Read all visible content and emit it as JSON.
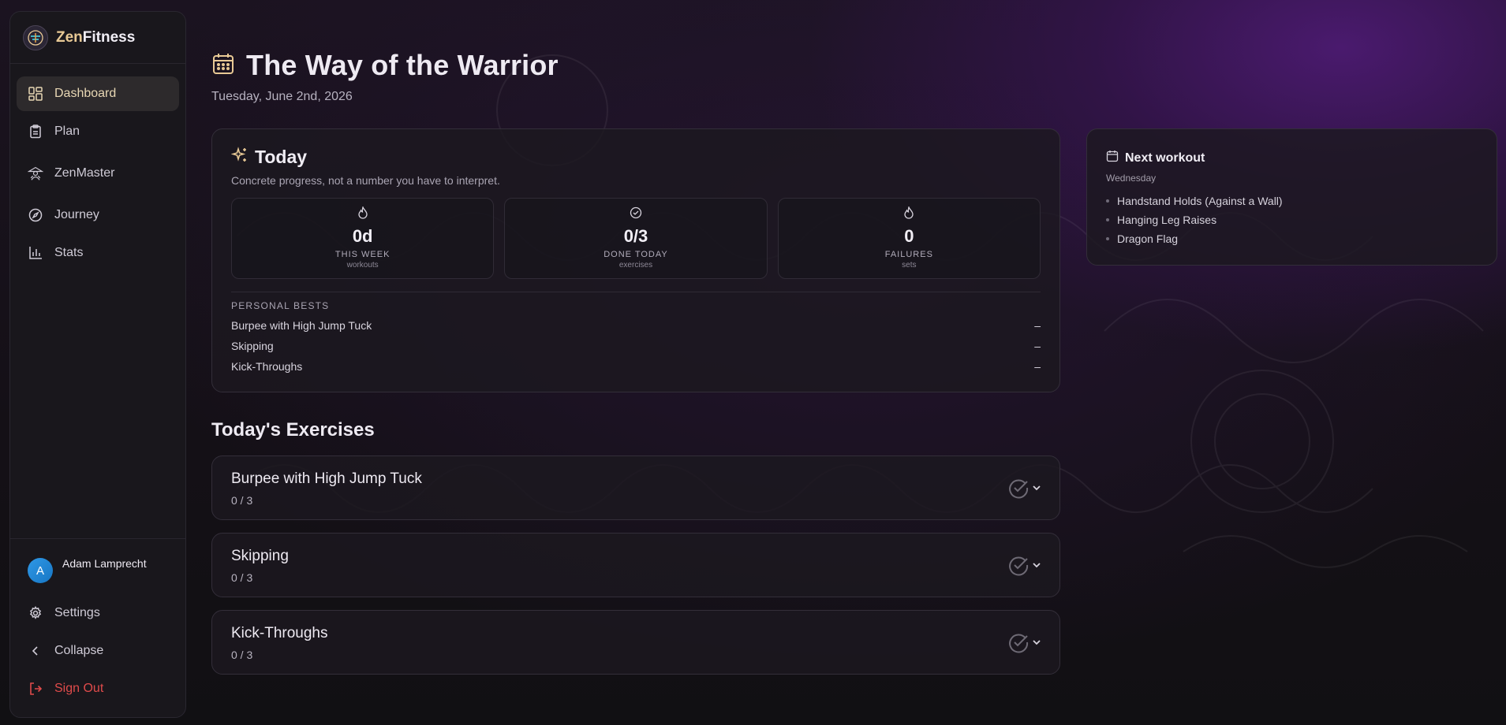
{
  "brand": {
    "name_prefix": "Zen",
    "name_suffix": "Fitness"
  },
  "sidebar": {
    "items": [
      {
        "label": "Dashboard",
        "icon": "dashboard-icon",
        "active": true
      },
      {
        "label": "Plan",
        "icon": "clipboard-icon",
        "active": false
      },
      {
        "label": "ZenMaster",
        "icon": "master-icon",
        "active": false
      },
      {
        "label": "Journey",
        "icon": "compass-icon",
        "active": false
      },
      {
        "label": "Stats",
        "icon": "bar-chart-icon",
        "active": false
      }
    ],
    "user": {
      "initial": "A",
      "name": "Adam Lamprecht"
    },
    "settings_label": "Settings",
    "collapse_label": "Collapse",
    "signout_label": "Sign Out"
  },
  "header": {
    "title": "The Way of the Warrior",
    "date": "Tuesday, June 2nd, 2026"
  },
  "today": {
    "title": "Today",
    "subtitle": "Concrete progress, not a number you have to interpret.",
    "stats": [
      {
        "value": "0d",
        "label": "THIS WEEK",
        "unit": "workouts",
        "icon": "flame-icon"
      },
      {
        "value": "0/3",
        "label": "DONE TODAY",
        "unit": "exercises",
        "icon": "check-circle-icon"
      },
      {
        "value": "0",
        "label": "FAILURES",
        "unit": "sets",
        "icon": "flame-icon"
      }
    ],
    "personal_bests_heading": "PERSONAL BESTS",
    "personal_bests": [
      {
        "name": "Burpee with High Jump Tuck",
        "value": "–"
      },
      {
        "name": "Skipping",
        "value": "–"
      },
      {
        "name": "Kick-Throughs",
        "value": "–"
      }
    ]
  },
  "next_workout": {
    "title": "Next workout",
    "day": "Wednesday",
    "exercises": [
      "Handstand Holds (Against a Wall)",
      "Hanging Leg Raises",
      "Dragon Flag"
    ]
  },
  "exercises_section": {
    "title": "Today's Exercises",
    "items": [
      {
        "name": "Burpee with High Jump Tuck",
        "progress": "0 / 3"
      },
      {
        "name": "Skipping",
        "progress": "0 / 3"
      },
      {
        "name": "Kick-Throughs",
        "progress": "0 / 3"
      }
    ]
  },
  "colors": {
    "accent": "#e8c995",
    "danger": "#e04b4b",
    "avatar": "#2f98e6"
  }
}
